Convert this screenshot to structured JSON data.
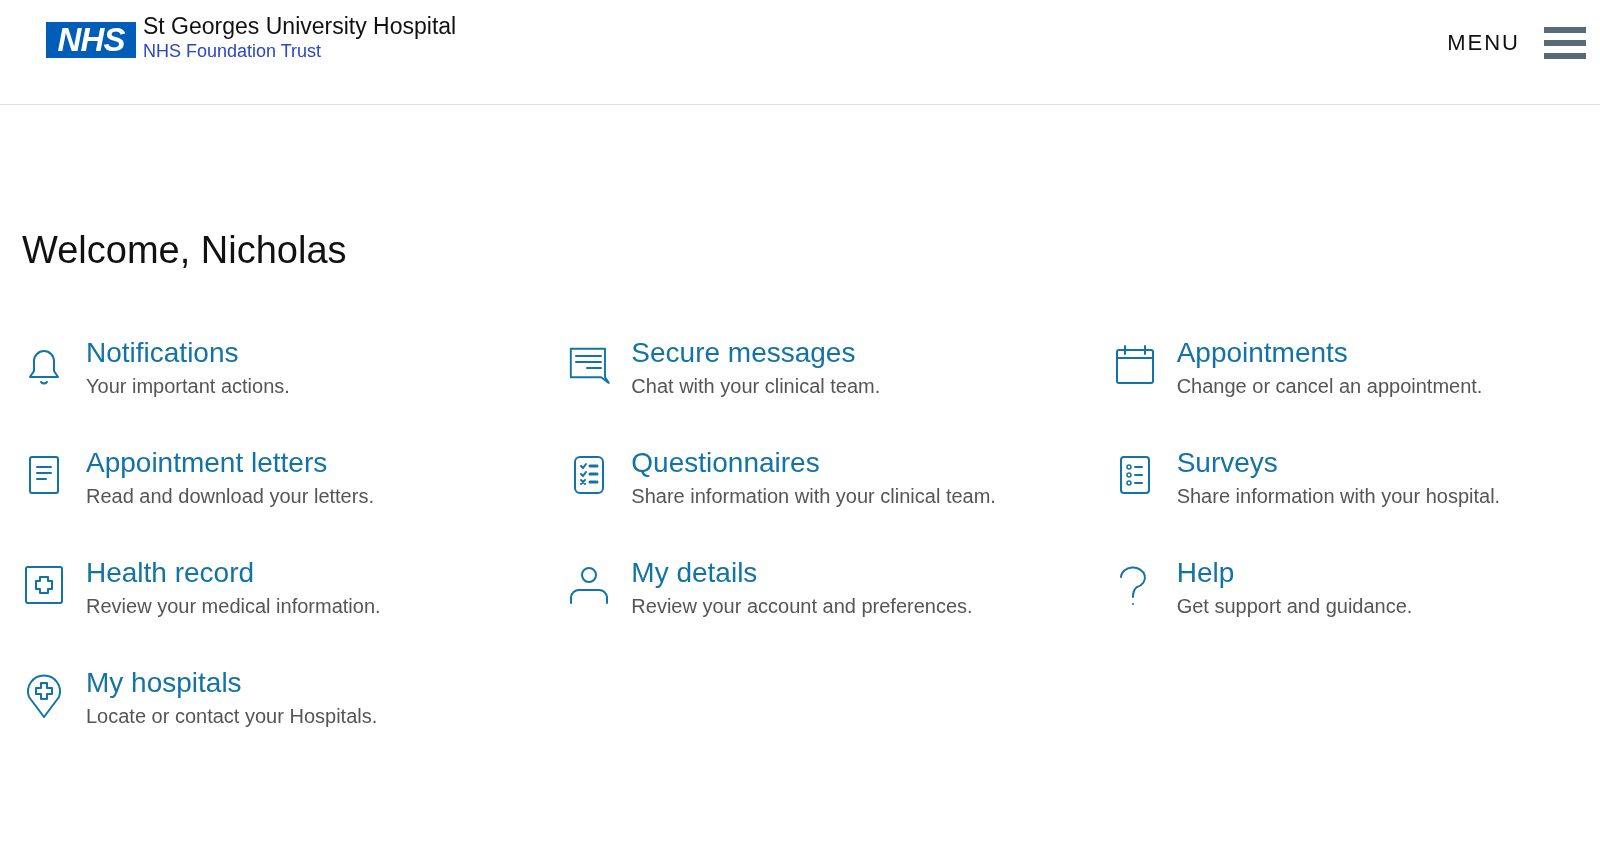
{
  "header": {
    "logo": "NHS",
    "hospital_name": "St Georges University Hospital",
    "trust_name": "NHS Foundation Trust",
    "menu_label": "MENU"
  },
  "welcome": "Welcome, Nicholas",
  "tiles": [
    {
      "title": "Notifications",
      "description": "Your important actions."
    },
    {
      "title": "Secure messages",
      "description": "Chat with your clinical team."
    },
    {
      "title": "Appointments",
      "description": "Change or cancel an appointment."
    },
    {
      "title": "Appointment letters",
      "description": "Read and download your letters."
    },
    {
      "title": "Questionnaires",
      "description": "Share information with your clinical team."
    },
    {
      "title": "Surveys",
      "description": "Share information with your hospital."
    },
    {
      "title": "Health record",
      "description": "Review your medical information."
    },
    {
      "title": "My details",
      "description": "Review your account and preferences."
    },
    {
      "title": "Help",
      "description": "Get support and guidance."
    },
    {
      "title": "My hospitals",
      "description": "Locate or contact your Hospitals."
    }
  ]
}
